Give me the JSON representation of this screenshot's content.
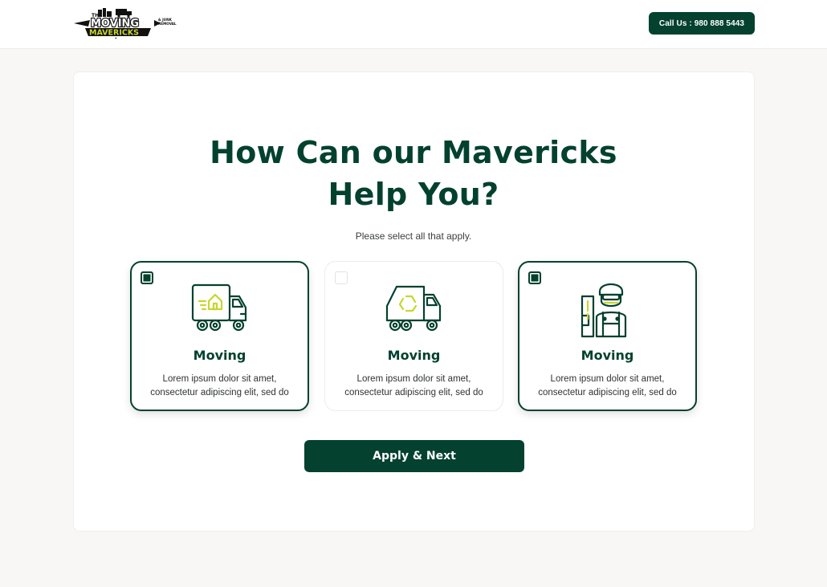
{
  "header": {
    "logo_alt": "The Moving Mavericks & Junk Removal",
    "logo_text_top": "THE",
    "logo_text_main": "MOVING",
    "logo_text_sub": "MAVERICKS",
    "logo_text_side_1": "& JUNK",
    "logo_text_side_2": "REMOVAL",
    "call_label": "Call Us : 980 888 5443"
  },
  "main": {
    "title_line1": "How Can our Mavericks",
    "title_line2": "Help You?",
    "subtitle": "Please select all that apply.",
    "options": [
      {
        "title": "Moving",
        "desc_line1": "Lorem ipsum dolor sit amet,",
        "desc_line2": "consectetur adipiscing elit, sed do",
        "selected": true,
        "icon": "moving-truck-icon"
      },
      {
        "title": "Moving",
        "desc_line1": "Lorem ipsum dolor sit amet,",
        "desc_line2": "consectetur adipiscing elit, sed do",
        "selected": false,
        "icon": "recycling-truck-icon"
      },
      {
        "title": "Moving",
        "desc_line1": "Lorem ipsum dolor sit amet,",
        "desc_line2": "consectetur adipiscing elit, sed do",
        "selected": true,
        "icon": "mover-worker-icon"
      }
    ],
    "apply_label": "Apply & Next"
  },
  "colors": {
    "brand_dark_green": "#04412f",
    "accent_lime": "#c8d62c",
    "page_bg": "#f8f7f5",
    "card_bg": "#ffffff"
  }
}
